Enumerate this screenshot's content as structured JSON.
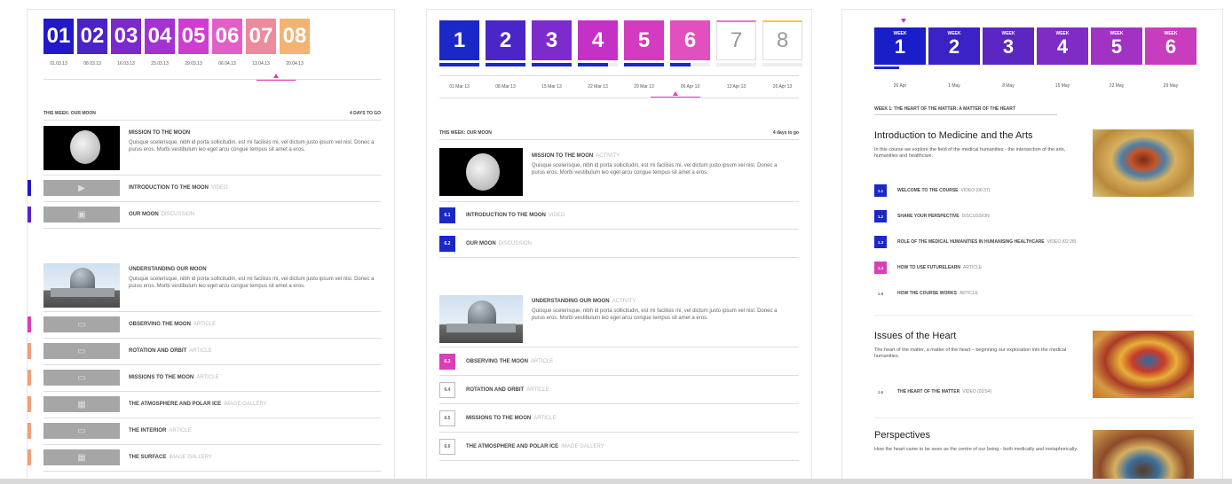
{
  "panel1": {
    "weeks": [
      {
        "n": "01",
        "date": "01.03.13",
        "color": "#2319c8"
      },
      {
        "n": "02",
        "date": "08.03.13",
        "color": "#4a22c8"
      },
      {
        "n": "03",
        "date": "16.03.13",
        "color": "#7a29cd"
      },
      {
        "n": "04",
        "date": "23.03.13",
        "color": "#a431d0"
      },
      {
        "n": "05",
        "date": "29.03.13",
        "color": "#cf3cd2"
      },
      {
        "n": "06",
        "date": "06.04.13",
        "color": "#e35fc8"
      },
      {
        "n": "07",
        "date": "13.04.13",
        "color": "#ec8a9e"
      },
      {
        "n": "08",
        "date": "20.04.13",
        "color": "#f2b473"
      }
    ],
    "week_title": "THIS WEEK: OUR MOON",
    "days_to_go": "4 DAYS TO GO",
    "act1_title": "MISSION TO THE MOON",
    "act1_desc": "Quisque scelerisque, nibh id porta sollicitudin, est mi facilisis mi, vel dictum justo ipsum vel nisl. Donec a purus eros. Morbi vestibulum leo eget arcu congue tempus sit amet a eros.",
    "act1_items": [
      {
        "label": "INTRODUCTION TO THE MOON",
        "type": "VIDEO",
        "color": "#2319c8",
        "glyph": "▶"
      },
      {
        "label": "OUR MOON",
        "type": "DISCUSSION",
        "color": "#5a22c8",
        "glyph": "▣"
      }
    ],
    "act2_title": "UNDERSTANDING OUR MOON",
    "act2_desc": "Quisque scelerisque, nibh id porta sollicitudin, est mi facilisis mi, vel dictum justo ipsum vel nisl. Donec a purus eros. Morbi vestibulum leo eget arcu congue tempus sit amet a eros.",
    "act2_items": [
      {
        "label": "OBSERVING THE MOON",
        "type": "ARTICLE",
        "color": "#d93fb8",
        "glyph": "▭"
      },
      {
        "label": "ROTATION AND ORBIT",
        "type": "ARTICLE",
        "color": "#f0a07a",
        "glyph": "▭"
      },
      {
        "label": "MISSIONS TO THE MOON",
        "type": "ARTICLE",
        "color": "#f0a07a",
        "glyph": "▭"
      },
      {
        "label": "THE ATMOSPHERE AND POLAR ICE",
        "type": "IMAGE GALLERY",
        "color": "#f0a07a",
        "glyph": "▦"
      },
      {
        "label": "THE INTERIOR",
        "type": "ARTICLE",
        "color": "#f0a07a",
        "glyph": "▭"
      },
      {
        "label": "THE SURFACE",
        "type": "IMAGE GALLERY",
        "color": "#f0a07a",
        "glyph": "▦"
      }
    ]
  },
  "panel2": {
    "weeks": [
      {
        "n": "1",
        "date": "01 Mar 13",
        "color": "#1a28c8",
        "prog": 1
      },
      {
        "n": "2",
        "date": "08 Mar 13",
        "color": "#4a26c8",
        "prog": 1
      },
      {
        "n": "3",
        "date": "15 Mar 13",
        "color": "#7c2ccd",
        "prog": 1
      },
      {
        "n": "4",
        "date": "22 Mar 13",
        "color": "#c531c7",
        "prog": 0.75
      },
      {
        "n": "5",
        "date": "29 Mar 13",
        "color": "#d43bc0",
        "prog": 1
      },
      {
        "n": "6",
        "date": "06 Apr 13",
        "color": "#e24fbe",
        "prog": 0.5
      },
      {
        "n": "7",
        "date": "13 Apr 13",
        "color": "",
        "prog": 0
      },
      {
        "n": "8",
        "date": "20 Apr 13",
        "color": "",
        "prog": 0
      }
    ],
    "week_title": "THIS WEEK: OUR MOON",
    "days_to_go": "4 days to go",
    "act1_title": "MISSION TO THE MOON",
    "act1_type": "ACTIVITY",
    "act1_desc": "Quisque scelerisque, nibh id porta sollicitudin, est mi facilisis mi, vel dictum justo ipsum vel nisl. Donec a purus eros. Morbi vestibulum leo eget arcu congue tempus sit amet a eros.",
    "act1_items": [
      {
        "num": "6.1",
        "label": "INTRODUCTION TO THE MOON",
        "type": "VIDEO",
        "fill": "#1a28c8"
      },
      {
        "num": "6.2",
        "label": "OUR MOON",
        "type": "DISCUSSION",
        "fill": "#1a28c8"
      }
    ],
    "act2_title": "UNDERSTANDING OUR MOON",
    "act2_type": "ACTIVITY",
    "act2_desc": "Quisque scelerisque, nibh id porta sollicitudin, est mi facilisis mi, vel dictum justo ipsum vel nisl. Donec a purus eros. Morbi vestibulum leo eget arcu congue tempus sit amet a eros.",
    "act2_items": [
      {
        "num": "6.3",
        "label": "OBSERVING THE MOON",
        "type": "ARTICLE",
        "fill": "#d93fb8"
      },
      {
        "num": "6.4",
        "label": "ROTATION AND ORBIT",
        "type": "ARTICLE",
        "fill": ""
      },
      {
        "num": "6.5",
        "label": "MISSIONS TO THE MOON",
        "type": "ARTICLE",
        "fill": ""
      },
      {
        "num": "6.6",
        "label": "THE ATMOSPHERE AND POLAR ICE",
        "type": "IMAGE GALLERY",
        "fill": ""
      }
    ]
  },
  "panel3": {
    "week_word": "WEEK",
    "weeks": [
      {
        "n": "1",
        "date": "26 Apr",
        "color": "#1a1ec8"
      },
      {
        "n": "2",
        "date": "1 May",
        "color": "#3a22c4"
      },
      {
        "n": "3",
        "date": "8 May",
        "color": "#5c26c2"
      },
      {
        "n": "4",
        "date": "15 May",
        "color": "#7e2cc4"
      },
      {
        "n": "5",
        "date": "22 May",
        "color": "#a232c4"
      },
      {
        "n": "6",
        "date": "29 May",
        "color": "#c83cbe"
      }
    ],
    "week_header": "WEEK 1: THE HEART OF THE MATTER: A MATTER OF THE HEART",
    "s1_title": "Introduction to Medicine and the Arts",
    "s1_desc": "In this course we explore the field of the medical humanities - the intersection of the arts, humanities and healthcare.",
    "s1_items": [
      {
        "num": "1.1",
        "label": "WELCOME TO THE COURSE",
        "type": "VIDEO (06:37)",
        "fill": "#1a28c8"
      },
      {
        "num": "1.2",
        "label": "SHARE YOUR PERSPECTIVE",
        "type": "DISCUSSION",
        "fill": "#1a28c8"
      },
      {
        "num": "1.3",
        "label": "ROLE OF THE MEDICAL HUMANITIES IN HUMANISING HEALTHCARE",
        "type": "VIDEO (02:28)",
        "fill": "#1a28c8"
      },
      {
        "num": "1.4",
        "label": "HOW TO USE FUTURELEARN",
        "type": "ARTICLE",
        "fill": "#d93fb8"
      },
      {
        "num": "1.5",
        "label": "HOW THE COURSE WORKS",
        "type": "ARTICLE",
        "fill": ""
      }
    ],
    "s2_title": "Issues of the Heart",
    "s2_desc": "The heart of the matter, a matter of the heart – beginning our exploration into the medical humanities.",
    "s2_items": [
      {
        "num": "1.6",
        "label": "THE HEART OF THE MATTER",
        "type": "VIDEO (03:54)",
        "fill": ""
      }
    ],
    "s3_title": "Perspectives",
    "s3_desc": "How the heart came to be seen as the centre of our being - both medically and metaphorically."
  }
}
